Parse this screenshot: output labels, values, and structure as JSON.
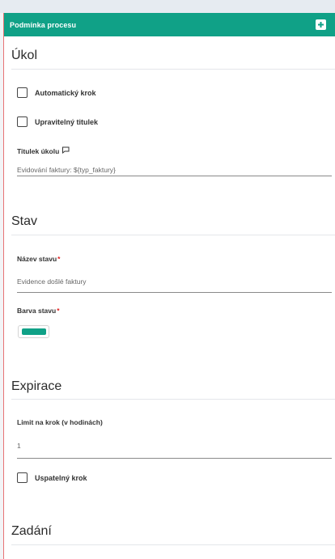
{
  "panel": {
    "title": "Podmínka procesu",
    "toggle_icon": "plus-square-icon",
    "accent_color": "#10a187"
  },
  "ukol": {
    "heading": "Úkol",
    "automatic_step_label": "Automatický krok",
    "automatic_step_checked": false,
    "editable_title_label": "Upravitelný titulek",
    "editable_title_checked": false,
    "task_title_label": "Titulek úkolu",
    "task_title_icon": "comment-icon",
    "task_title_value": "Evidování faktury: ${typ_faktury}"
  },
  "stav": {
    "heading": "Stav",
    "name_label": "Název stavu",
    "name_required_marker": "*",
    "name_value": "Evidence došlé faktury",
    "color_label": "Barva stavu",
    "color_required_marker": "*",
    "color_value": "#10a187"
  },
  "expirace": {
    "heading": "Expirace",
    "limit_label": "Limit na krok (v hodinách)",
    "limit_value": "1",
    "sleepy_step_label": "Uspatelný krok",
    "sleepy_step_checked": false
  },
  "zadani": {
    "heading": "Zadání"
  }
}
